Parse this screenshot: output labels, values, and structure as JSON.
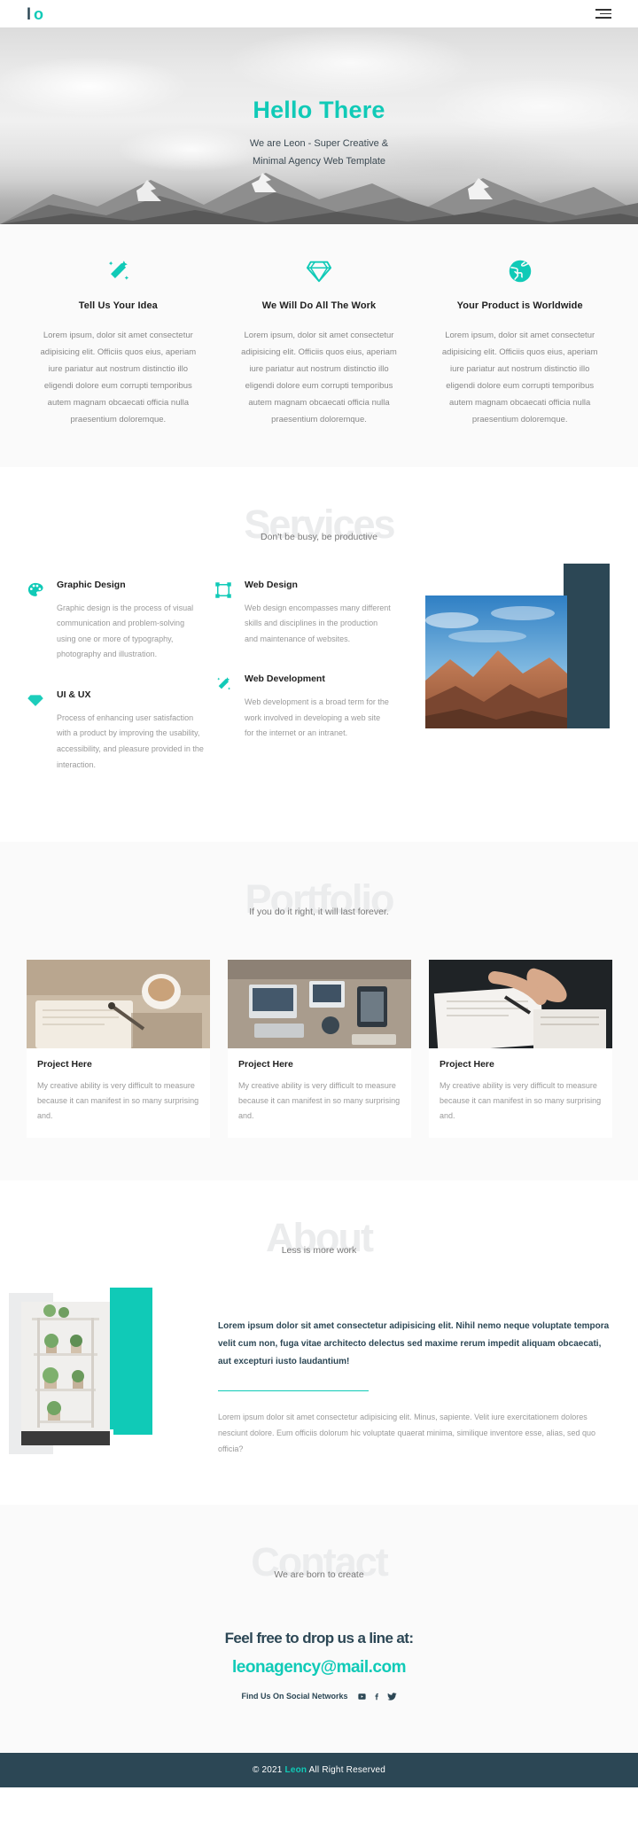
{
  "theme": {
    "accent": "#10cab7",
    "dark": "#2c4755",
    "muted": "#9a9a9a",
    "section_bg": "#fafafa",
    "ghost_heading": "#ebeced"
  },
  "header": {
    "logo_bar": "l",
    "logo_mark": "o",
    "menu_icon": "hamburger-icon"
  },
  "hero": {
    "title": "Hello There",
    "subtitle_line1": "We are Leon - Super Creative &",
    "subtitle_line2": "Minimal Agency Web Template"
  },
  "features": [
    {
      "icon": "magic-wand-icon",
      "title": "Tell Us Your Idea",
      "text": "Lorem ipsum, dolor sit amet consectetur adipisicing elit. Officiis quos eius, aperiam iure pariatur aut nostrum distinctio illo eligendi dolore eum corrupti temporibus autem magnam obcaecati officia nulla praesentium doloremque."
    },
    {
      "icon": "gem-icon",
      "title": "We Will Do All The Work",
      "text": "Lorem ipsum, dolor sit amet consectetur adipisicing elit. Officiis quos eius, aperiam iure pariatur aut nostrum distinctio illo eligendi dolore eum corrupti temporibus autem magnam obcaecati officia nulla praesentium doloremque."
    },
    {
      "icon": "globe-icon",
      "title": "Your Product is Worldwide",
      "text": "Lorem ipsum, dolor sit amet consectetur adipisicing elit. Officiis quos eius, aperiam iure pariatur aut nostrum distinctio illo eligendi dolore eum corrupti temporibus autem magnam obcaecati officia nulla praesentium doloremque."
    }
  ],
  "services": {
    "heading": "Services",
    "tagline": "Don't be busy, be productive",
    "items": [
      {
        "icon": "palette-icon",
        "title": "Graphic Design",
        "text": "Graphic design is the process of visual communication and problem-solving using one or more of typography, photography and illustration."
      },
      {
        "icon": "crop-frame-icon",
        "title": "Web Design",
        "text": "Web design encompasses many different skills and disciplines in the production and maintenance of websites."
      },
      {
        "icon": "diamond-icon",
        "title": "UI & UX",
        "text": "Process of enhancing user satisfaction with a product by improving the usability, accessibility, and pleasure provided in the interaction."
      },
      {
        "icon": "magic-wand-icon",
        "title": "Web Development",
        "text": "Web development is a broad term for the work involved in developing a web site for the internet or an intranet."
      }
    ],
    "image_alt": "mountain-landscape-photo"
  },
  "portfolio": {
    "heading": "Portfolio",
    "tagline": "If you do it right, it will last forever.",
    "cards": [
      {
        "image_alt": "writing-notebook-photo",
        "title": "Project Here",
        "text": "My creative ability is very difficult to measure because it can manifest in so many surprising and."
      },
      {
        "image_alt": "desk-devices-photo",
        "title": "Project Here",
        "text": "My creative ability is very difficult to measure because it can manifest in so many surprising and."
      },
      {
        "image_alt": "hands-sketching-photo",
        "title": "Project Here",
        "text": "My creative ability is very difficult to measure because it can manifest in so many surprising and."
      }
    ]
  },
  "about": {
    "heading": "About",
    "tagline": "Less is more work",
    "image_alt": "plant-shelf-photo",
    "paragraph_bold": "Lorem ipsum dolor sit amet consectetur adipisicing elit. Nihil nemo neque voluptate tempora velit cum non, fuga vitae architecto delectus sed maxime rerum impedit aliquam obcaecati, aut excepturi iusto laudantium!",
    "paragraph_muted": "Lorem ipsum dolor sit amet consectetur adipisicing elit. Minus, sapiente. Velit iure exercitationem dolores nesciunt dolore. Eum officiis dolorum hic voluptate quaerat minima, similique inventore esse, alias, sed quo officia?"
  },
  "contact": {
    "heading": "Contact",
    "tagline": "We are born to create",
    "label": "Feel free to drop us a line at:",
    "email": "leonagency@mail.com",
    "social_label": "Find Us On Social Networks",
    "social_icons": [
      "youtube-icon",
      "facebook-icon",
      "twitter-icon"
    ]
  },
  "footer": {
    "prefix": "© 2021 ",
    "brand": "Leon",
    "suffix": " All Right Reserved"
  }
}
